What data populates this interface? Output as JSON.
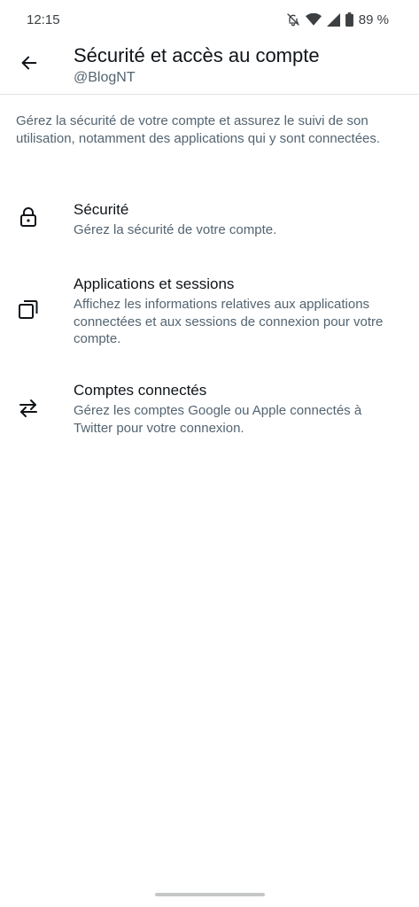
{
  "status_bar": {
    "time": "12:15",
    "battery": "89 %"
  },
  "header": {
    "title": "Sécurité et accès au compte",
    "subtitle": "@BlogNT"
  },
  "intro": "Gérez la sécurité de votre compte et assurez le suivi de son utilisation, notamment des applications qui y sont connectées.",
  "menu": {
    "items": [
      {
        "icon": "lock-icon",
        "title": "Sécurité",
        "description": "Gérez la sécurité de votre compte."
      },
      {
        "icon": "sessions-icon",
        "title": "Applications et sessions",
        "description": "Affichez les informations relatives aux applications connectées et aux sessions de connexion pour votre compte."
      },
      {
        "icon": "swap-arrows-icon",
        "title": "Comptes connectés",
        "description": "Gérez les comptes Google ou Apple connectés à Twitter pour votre connexion."
      }
    ]
  },
  "colors": {
    "primary_text": "#0f1419",
    "secondary_text": "#536471",
    "divider": "#e1e4e8"
  }
}
